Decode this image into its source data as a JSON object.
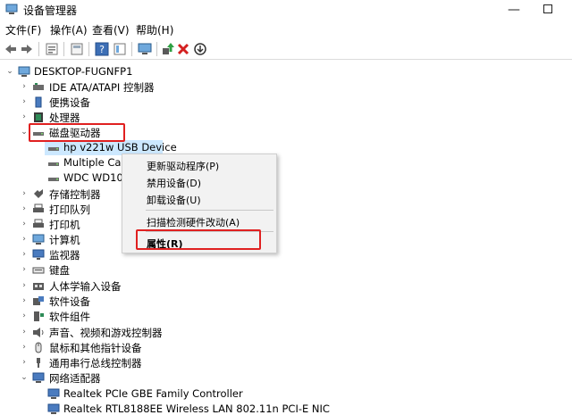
{
  "window": {
    "title": "设备管理器",
    "minimize_glyph": "—"
  },
  "menu": [
    "文件(F)",
    "操作(A)",
    "查看(V)",
    "帮助(H)"
  ],
  "toolbar_icons": [
    "back-arrow-icon",
    "forward-arrow-icon",
    "properties-icon",
    "view-icon",
    "help-icon",
    "panel-icon",
    "monitor-icon",
    "update-driver-icon",
    "uninstall-icon",
    "scan-icon"
  ],
  "tree": {
    "root": "DESKTOP-FUGNFP1",
    "categories": [
      "IDE ATA/ATAPI 控制器",
      "便携设备",
      "处理器",
      "磁盘驱动器",
      "hp v221w USB Device",
      "Multiple Card",
      "WDC WD10S",
      "存储控制器",
      "打印队列",
      "打印机",
      "计算机",
      "监视器",
      "键盘",
      "人体学输入设备",
      "软件设备",
      "软件组件",
      "声音、视频和游戏控制器",
      "鼠标和其他指针设备",
      "通用串行总线控制器",
      "网络适配器",
      "Realtek PCIe GBE Family Controller",
      "Realtek RTL8188EE Wireless LAN 802.11n PCI-E NIC"
    ]
  },
  "context_menu": {
    "items": [
      "更新驱动程序(P)",
      "禁用设备(D)",
      "卸载设备(U)",
      "扫描检测硬件改动(A)",
      "属性(R)"
    ]
  },
  "colors": {
    "selection": "#cce8ff",
    "highlight": "#e02020",
    "menu_bg": "#f2f2f2"
  }
}
